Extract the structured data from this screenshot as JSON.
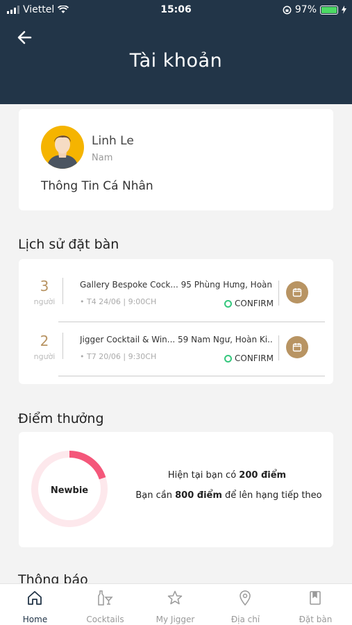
{
  "status_bar": {
    "carrier": "Viettel",
    "time": "15:06",
    "battery": "97%"
  },
  "header": {
    "title": "Tài khoản"
  },
  "profile": {
    "name": "Linh Le",
    "gender": "Nam",
    "info_link": "Thông Tin Cá Nhân"
  },
  "booking": {
    "section_title": "Lịch sử đặt bàn",
    "items": [
      {
        "count": "3",
        "unit": "người",
        "venue": "Gallery Bespoke Cock... 95 Phùng Hưng, Hoàn...",
        "date": "• T4 24/06 | 9:00CH",
        "status": "CONFIRM"
      },
      {
        "count": "2",
        "unit": "người",
        "venue": "Jigger Cocktail & Win... 59 Nam Ngư, Hoàn Ki...",
        "date": "• T7 20/06 | 9:30CH",
        "status": "CONFIRM"
      }
    ]
  },
  "points": {
    "section_title": "Điểm thưởng",
    "rank": "Newbie",
    "current_prefix": "Hiện tại bạn có ",
    "current_points": "200 điểm",
    "need_prefix": "Bạn cần ",
    "need_points": "800 điểm",
    "need_suffix": " để lên hạng tiếp theo",
    "progress": 0.2
  },
  "notifications": {
    "section_title": "Thông báo"
  },
  "tabs": [
    {
      "label": "Home",
      "icon": "home-icon",
      "active": true
    },
    {
      "label": "Cocktails",
      "icon": "cocktail-icon",
      "active": false
    },
    {
      "label": "My Jigger",
      "icon": "star-icon",
      "active": false
    },
    {
      "label": "Địa chỉ",
      "icon": "location-pin-icon",
      "active": false
    },
    {
      "label": "Đặt bàn",
      "icon": "bookmark-icon",
      "active": false
    }
  ],
  "colors": {
    "header_bg": "#223548",
    "accent_gold": "#b89463",
    "progress_pink": "#f4577a",
    "confirm_green": "#35c77d"
  }
}
